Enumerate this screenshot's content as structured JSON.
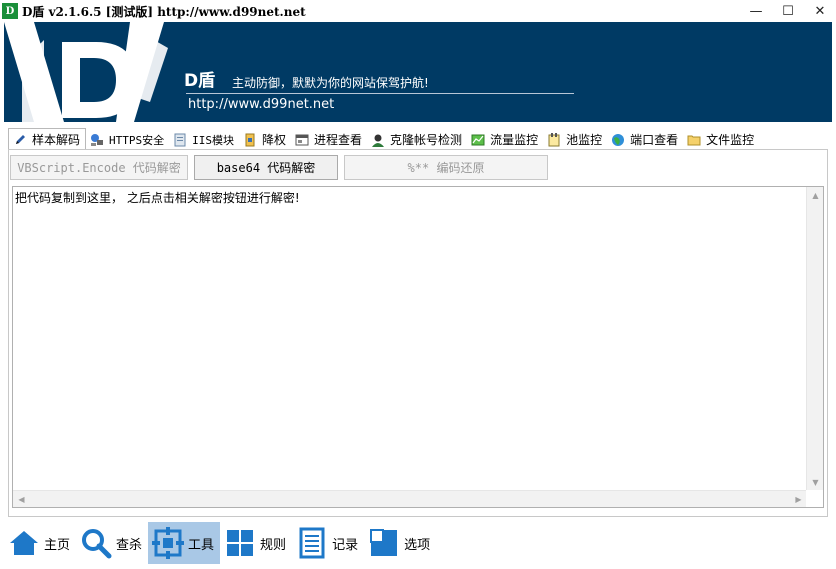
{
  "window": {
    "title": "D盾 v2.1.6.5 [测试版] http://www.d99net.net",
    "minimize": "—",
    "maximize": "☐",
    "close": "✕"
  },
  "banner": {
    "name": "D盾",
    "slogan": "主动防御，默默为你的网站保驾护航!",
    "url": "http://www.d99net.net"
  },
  "tabs": [
    {
      "label": "样本解码",
      "icon": "pen-icon"
    },
    {
      "label": "HTTPS安全",
      "icon": "network-icon"
    },
    {
      "label": "IIS模块",
      "icon": "module-icon"
    },
    {
      "label": "降权",
      "icon": "lock-icon"
    },
    {
      "label": "进程查看",
      "icon": "window-icon"
    },
    {
      "label": "克隆帐号检测",
      "icon": "user-icon"
    },
    {
      "label": "流量监控",
      "icon": "chart-icon"
    },
    {
      "label": "池监控",
      "icon": "notepad-icon"
    },
    {
      "label": "端口查看",
      "icon": "globe-icon"
    },
    {
      "label": "文件监控",
      "icon": "folder-icon"
    }
  ],
  "buttons": {
    "vbscript": "VBScript.Encode 代码解密",
    "base64": "base64 代码解密",
    "percent": "%** 编码还原"
  },
  "textarea": {
    "content": "把代码复制到这里， 之后点击相关解密按钮进行解密!"
  },
  "nav": [
    {
      "label": "主页"
    },
    {
      "label": "查杀"
    },
    {
      "label": "工具"
    },
    {
      "label": "规则"
    },
    {
      "label": "记录"
    },
    {
      "label": "选项"
    }
  ],
  "colors": {
    "banner": "#003a64",
    "nav_active": "#a9c8e6",
    "nav_icon": "#1e78c8"
  }
}
